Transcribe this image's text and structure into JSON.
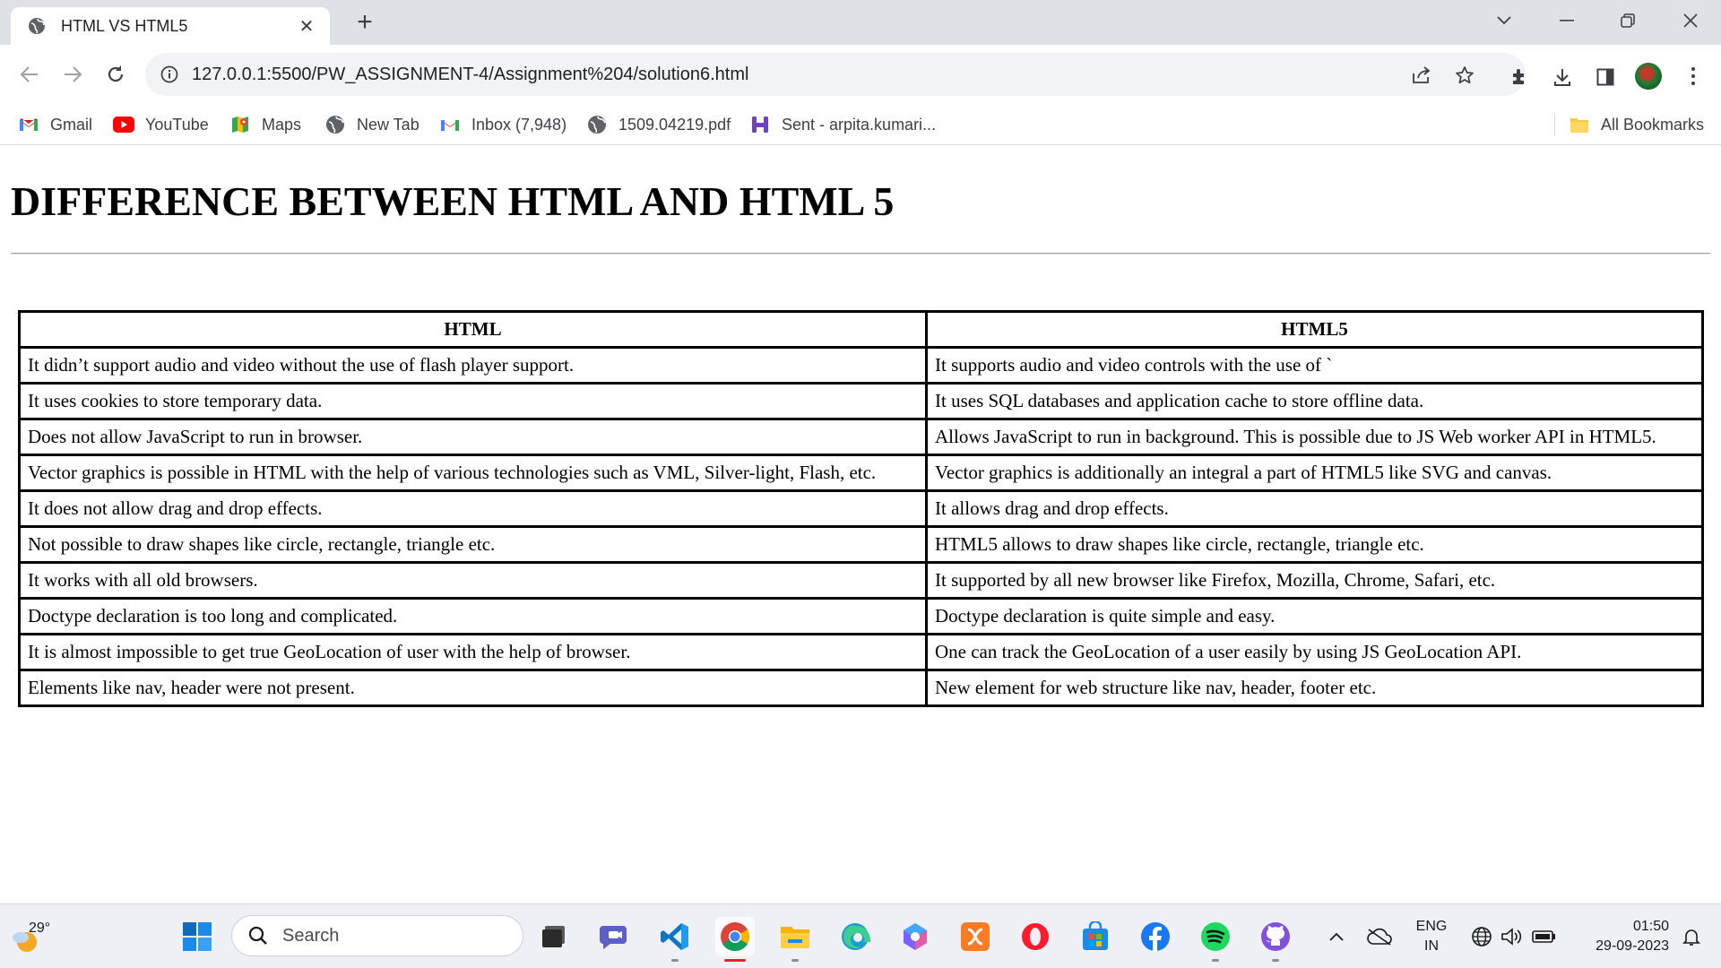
{
  "browser": {
    "tab": {
      "title": "HTML VS HTML5",
      "favicon": "globe-icon"
    },
    "address": {
      "url": "127.0.0.1:5500/PW_ASSIGNMENT-4/Assignment%204/solution6.html"
    },
    "bookmarks": [
      {
        "label": "Gmail",
        "icon": "gmail-icon"
      },
      {
        "label": "YouTube",
        "icon": "youtube-icon"
      },
      {
        "label": "Maps",
        "icon": "maps-icon"
      },
      {
        "label": "New Tab",
        "icon": "globe-icon"
      },
      {
        "label": "Inbox (7,948)",
        "icon": "gmail-icon"
      },
      {
        "label": "1509.04219.pdf",
        "icon": "globe-icon"
      },
      {
        "label": "Sent - arpita.kumari...",
        "icon": "slack-icon"
      }
    ],
    "all_bookmarks_label": "All Bookmarks"
  },
  "page": {
    "heading": "DIFFERENCE BETWEEN HTML AND HTML 5",
    "table": {
      "headers": [
        "HTML",
        "HTML5"
      ],
      "rows": [
        [
          "It didn’t support audio and video without the use of flash player support.",
          "It supports audio and video controls with the use of `"
        ],
        [
          "It uses cookies to store temporary data.",
          "It uses SQL databases and application cache to store offline data."
        ],
        [
          "Does not allow JavaScript to run in browser.",
          "Allows JavaScript to run in background. This is possible due to JS Web worker API in HTML5."
        ],
        [
          "Vector graphics is possible in HTML with the help of various technologies such as VML, Silver-light, Flash, etc.",
          "Vector graphics is additionally an integral a part of HTML5 like SVG and canvas."
        ],
        [
          "It does not allow drag and drop effects.",
          "It allows drag and drop effects."
        ],
        [
          "Not possible to draw shapes like circle, rectangle, triangle etc.",
          "HTML5 allows to draw shapes like circle, rectangle, triangle etc."
        ],
        [
          "It works with all old browsers.",
          "It supported by all new browser like Firefox, Mozilla, Chrome, Safari, etc."
        ],
        [
          "Doctype declaration is too long and complicated.",
          "Doctype declaration is quite simple and easy."
        ],
        [
          "It is almost impossible to get true GeoLocation of user with the help of browser.",
          "One can track the GeoLocation of a user easily by using JS GeoLocation API."
        ],
        [
          "Elements like nav, header were not present.",
          "New element for web structure like nav, header, footer etc."
        ]
      ]
    }
  },
  "taskbar": {
    "weather": {
      "temp": "29°"
    },
    "search_label": "Search",
    "apps": [
      "windows-start-icon",
      "task-view-icon",
      "chat-icon",
      "vscode-icon",
      "chrome-icon",
      "file-explorer-icon",
      "edge-icon",
      "copilot-icon",
      "xampp-icon",
      "opera-icon",
      "store-icon",
      "facebook-icon",
      "spotify-icon",
      "github-icon"
    ],
    "lang": {
      "line1": "ENG",
      "line2": "IN"
    },
    "clock": {
      "time": "01:50",
      "date": "29-09-2023"
    }
  }
}
